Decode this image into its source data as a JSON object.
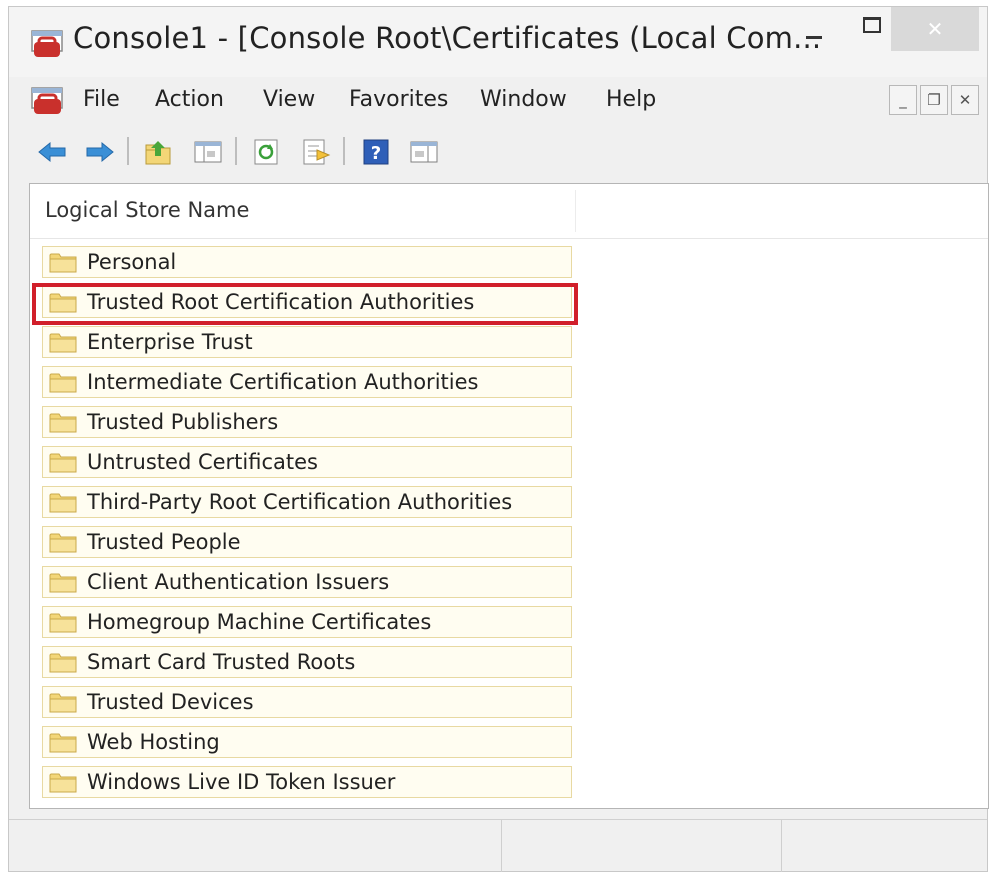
{
  "titlebar": {
    "title": "Console1 - [Console Root\\Certificates (Local Com...",
    "app_icon": "mmc-console-icon",
    "controls": {
      "minimize": "minimize-icon",
      "maximize": "maximize-icon",
      "close": "close-icon"
    }
  },
  "menubar": {
    "items": [
      "File",
      "Action",
      "View",
      "Favorites",
      "Window",
      "Help"
    ],
    "mdi_controls": [
      "minimize-icon",
      "restore-icon",
      "close-icon"
    ]
  },
  "toolbar": {
    "buttons": [
      "back-icon",
      "forward-icon",
      "up-one-level-icon",
      "show-hide-console-tree-icon",
      "refresh-icon",
      "export-list-icon",
      "help-icon",
      "show-hide-action-pane-icon"
    ]
  },
  "pane": {
    "column_header": "Logical Store Name",
    "items": [
      "Personal",
      "Trusted Root Certification Authorities",
      "Enterprise Trust",
      "Intermediate Certification Authorities",
      "Trusted Publishers",
      "Untrusted Certificates",
      "Third-Party Root Certification Authorities",
      "Trusted People",
      "Client Authentication Issuers",
      "Homegroup Machine Certificates",
      "Smart Card Trusted Roots",
      "Trusted Devices",
      "Web Hosting",
      "Windows Live ID Token Issuer"
    ],
    "highlighted_item": "Trusted Root Certification Authorities"
  },
  "colors": {
    "highlight_border": "#d11f2a",
    "row_background": "#fffdf1",
    "row_border": "#e8d9a2",
    "folder": "#f3d677",
    "nav_arrow": "#3a8fd6"
  }
}
